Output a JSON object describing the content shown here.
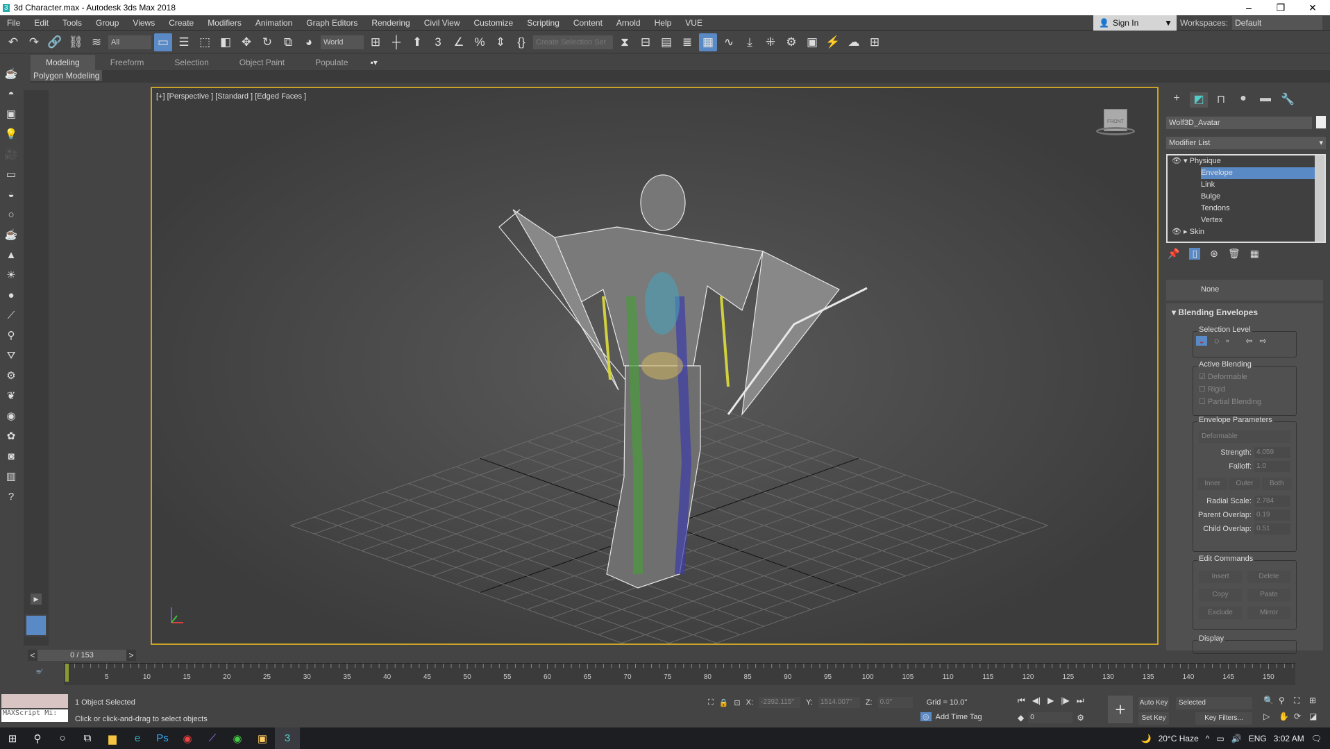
{
  "window": {
    "title": "3d Character.max - Autodesk 3ds Max 2018",
    "minimize": "–",
    "restore": "❐",
    "close": "✕"
  },
  "menu": [
    "File",
    "Edit",
    "Tools",
    "Group",
    "Views",
    "Create",
    "Modifiers",
    "Animation",
    "Graph Editors",
    "Rendering",
    "Civil View",
    "Customize",
    "Scripting",
    "Content",
    "Arnold",
    "Help",
    "VUE"
  ],
  "account": {
    "sign_in": "Sign In",
    "workspaces_label": "Workspaces:",
    "workspace": "Default"
  },
  "toolbar": {
    "filter": "All",
    "coord_system": "World",
    "selection_set_placeholder": "Create Selection Set"
  },
  "ribbon": {
    "tabs": [
      "Modeling",
      "Freeform",
      "Selection",
      "Object Paint",
      "Populate"
    ],
    "active": "Modeling",
    "panel": "Polygon Modeling"
  },
  "viewport": {
    "label": "[+] [Perspective ] [Standard ] [Edged Faces ]",
    "viewcube": "FRONT"
  },
  "command_panel": {
    "object_name": "Wolf3D_Avatar",
    "modifier_list": "Modifier List",
    "stack": [
      {
        "label": "Physique",
        "level": 0
      },
      {
        "label": "Envelope",
        "level": 1,
        "selected": true
      },
      {
        "label": "Link",
        "level": 1
      },
      {
        "label": "Bulge",
        "level": 1
      },
      {
        "label": "Tendons",
        "level": 1
      },
      {
        "label": "Vertex",
        "level": 1
      },
      {
        "label": "Skin",
        "level": 0
      }
    ],
    "none_label": "None",
    "rollout_title": "Blending Envelopes",
    "selection_level": "Selection Level",
    "active_blending": {
      "title": "Active Blending",
      "deformable": "Deformable",
      "rigid": "Rigid",
      "partial": "Partial Blending",
      "deformable_checked": true
    },
    "envelope_params": {
      "title": "Envelope Parameters",
      "type": "Deformable",
      "strength_label": "Strength:",
      "strength": "4.059",
      "falloff_label": "Falloff:",
      "falloff": "1.0",
      "inner": "Inner",
      "outer": "Outer",
      "both": "Both",
      "radial_label": "Radial Scale:",
      "radial": "2.784",
      "parent_label": "Parent Overlap:",
      "parent": "0.19",
      "child_label": "Child Overlap:",
      "child": "0.51"
    },
    "edit_commands": {
      "title": "Edit Commands",
      "insert": "Insert",
      "delete": "Delete",
      "copy": "Copy",
      "paste": "Paste",
      "exclude": "Exclude",
      "mirror": "Mirror"
    },
    "display_title": "Display"
  },
  "timeline": {
    "frame": "0 / 153",
    "current": 0,
    "total": 153,
    "ticks": [
      "5",
      "10",
      "15",
      "20",
      "25",
      "30",
      "35",
      "40",
      "45",
      "50",
      "55",
      "60",
      "65",
      "70",
      "75",
      "80",
      "85",
      "90",
      "95",
      "100",
      "105",
      "110",
      "115",
      "120",
      "125",
      "130",
      "135",
      "140",
      "145",
      "150"
    ]
  },
  "status": {
    "selected": "1 Object Selected",
    "prompt": "Click or click-and-drag to select objects",
    "maxscript": "MAXScript Mi:",
    "x_label": "X:",
    "x": "-2392.115\"",
    "y_label": "Y:",
    "y": "1514.007\"",
    "z_label": "Z:",
    "z": "0.0\"",
    "grid": "Grid = 10.0\"",
    "add_time_tag": "Add Time Tag",
    "auto_key": "Auto Key",
    "set_key": "Set Key",
    "key_mode": "Selected",
    "key_filters": "Key Filters...",
    "frame_field": "0"
  },
  "taskbar": {
    "weather": "20°C  Haze",
    "lang": "ENG",
    "time": "3:02 AM"
  },
  "colors": {
    "accent": "#5a8ac6",
    "viewport_border": "#c9a227"
  }
}
